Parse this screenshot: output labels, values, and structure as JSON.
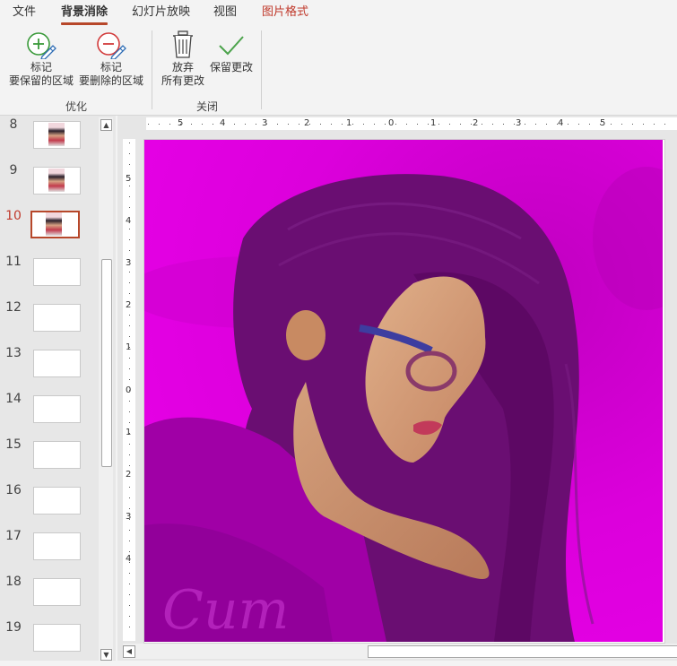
{
  "tabs": [
    {
      "label": "文件",
      "state": "normal"
    },
    {
      "label": "背景消除",
      "state": "active"
    },
    {
      "label": "幻灯片放映",
      "state": "normal"
    },
    {
      "label": "视图",
      "state": "normal"
    },
    {
      "label": "图片格式",
      "state": "context"
    }
  ],
  "ribbon": {
    "mark_keep": {
      "line1": "标记",
      "line2": "要保留的区域",
      "icon": "plus-pencil-icon"
    },
    "mark_remove": {
      "line1": "标记",
      "line2": "要删除的区域",
      "icon": "minus-pencil-icon"
    },
    "group_refine": "优化",
    "discard": {
      "line1": "放弃",
      "line2": "所有更改",
      "icon": "trash-icon"
    },
    "keep": {
      "line1": "保留更改",
      "icon": "checkmark-icon"
    },
    "group_close": "关闭"
  },
  "slides": [
    {
      "number": "8",
      "has_image": true,
      "selected": false
    },
    {
      "number": "9",
      "has_image": true,
      "selected": false
    },
    {
      "number": "10",
      "has_image": true,
      "selected": true
    },
    {
      "number": "11",
      "has_image": false,
      "selected": false
    },
    {
      "number": "12",
      "has_image": false,
      "selected": false
    },
    {
      "number": "13",
      "has_image": false,
      "selected": false
    },
    {
      "number": "14",
      "has_image": false,
      "selected": false
    },
    {
      "number": "15",
      "has_image": false,
      "selected": false
    },
    {
      "number": "16",
      "has_image": false,
      "selected": false
    },
    {
      "number": "17",
      "has_image": false,
      "selected": false
    },
    {
      "number": "18",
      "has_image": false,
      "selected": false
    },
    {
      "number": "19",
      "has_image": false,
      "selected": false
    }
  ],
  "ruler": {
    "horizontal": [
      "5",
      "4",
      "3",
      "2",
      "1",
      "0",
      "1",
      "2",
      "3",
      "4",
      "5"
    ],
    "vertical": [
      "5",
      "4",
      "3",
      "2",
      "1",
      "0",
      "1",
      "2",
      "3",
      "4"
    ]
  },
  "colors": {
    "accent": "#b7472a",
    "removal_overlay": "#e000e0",
    "context_tab": "#c0392b"
  }
}
